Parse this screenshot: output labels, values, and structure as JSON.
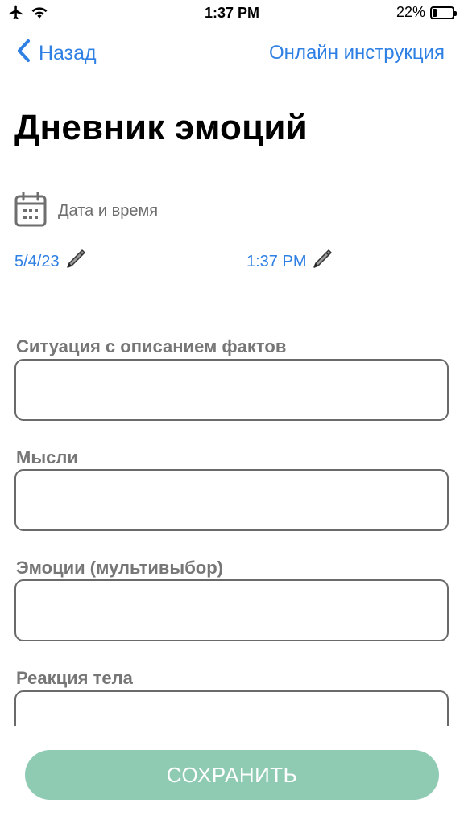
{
  "status_bar": {
    "time": "1:37 PM",
    "battery_percent": "22%",
    "battery_level": 0.22,
    "icons": [
      "airplane-icon",
      "wifi-icon",
      "battery-icon"
    ]
  },
  "nav": {
    "back_label": "Назад",
    "help_link": "Онлайн инструкция"
  },
  "title": "Дневник эмоций",
  "datetime": {
    "label": "Дата и время",
    "date": "5/4/23",
    "time": "1:37 PM"
  },
  "fields": [
    {
      "label": "Ситуация с описанием фактов",
      "value": ""
    },
    {
      "label": "Мысли",
      "value": ""
    },
    {
      "label": "Эмоции (мультивыбор)",
      "value": ""
    },
    {
      "label": "Реакция тела",
      "value": ""
    }
  ],
  "save_button": "СОХРАНИТЬ",
  "colors": {
    "accent": "#2f80e4",
    "save_button_bg": "#8fcbb3",
    "label_gray": "#767676"
  }
}
